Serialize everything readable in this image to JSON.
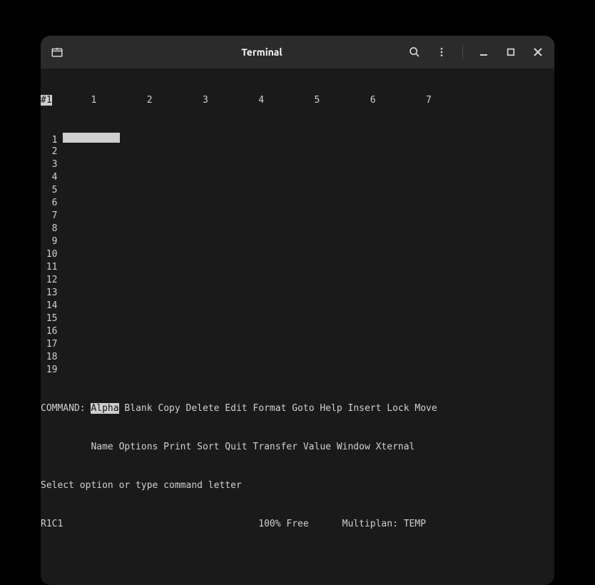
{
  "window": {
    "title": "Terminal"
  },
  "sheet": {
    "marker": "#1",
    "cols": [
      "1",
      "2",
      "3",
      "4",
      "5",
      "6",
      "7"
    ],
    "rows": [
      "1",
      "2",
      "3",
      "4",
      "5",
      "6",
      "7",
      "8",
      "9",
      "10",
      "11",
      "12",
      "13",
      "14",
      "15",
      "16",
      "17",
      "18",
      "19"
    ]
  },
  "command": {
    "label": "COMMAND: ",
    "selected": "Alpha",
    "line1_rest": " Blank Copy Delete Edit Format Goto Help Insert Lock Move",
    "line2": "         Name Options Print Sort Quit Transfer Value Window Xternal"
  },
  "prompt": "Select option or type command letter",
  "status": {
    "cell": "R1C1",
    "free": "100% Free",
    "app": "Multiplan: TEMP"
  }
}
